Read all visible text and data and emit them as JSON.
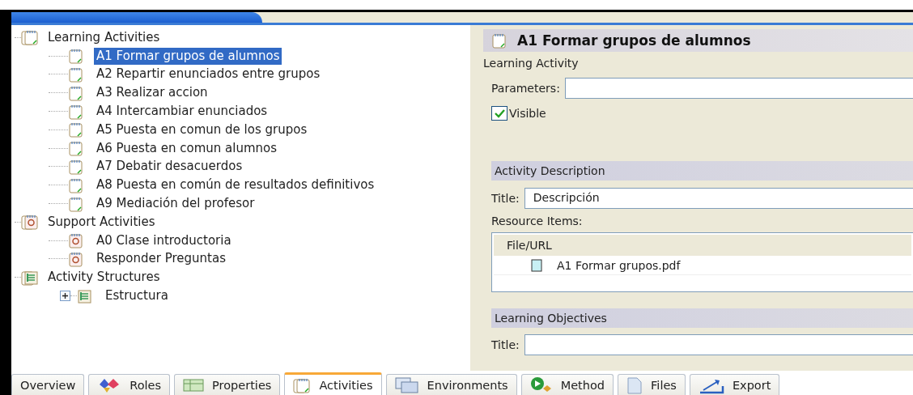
{
  "tree": [
    {
      "label": "Learning Activities",
      "kind": "activity",
      "selected": false,
      "children": [
        {
          "label": "A1 Formar grupos de alumnos",
          "kind": "activity",
          "selected": true
        },
        {
          "label": "A2 Repartir enunciados entre grupos",
          "kind": "activity",
          "selected": false
        },
        {
          "label": "A3 Realizar accion",
          "kind": "activity",
          "selected": false
        },
        {
          "label": "A4 Intercambiar enunciados",
          "kind": "activity",
          "selected": false
        },
        {
          "label": "A5 Puesta en comun de los grupos",
          "kind": "activity",
          "selected": false
        },
        {
          "label": "A6 Puesta en comun alumnos",
          "kind": "activity",
          "selected": false
        },
        {
          "label": "A7 Debatir desacuerdos",
          "kind": "activity",
          "selected": false
        },
        {
          "label": "A8 Puesta en común de resultados definitivos",
          "kind": "activity",
          "selected": false
        },
        {
          "label": "A9 Mediación del profesor",
          "kind": "activity",
          "selected": false
        }
      ]
    },
    {
      "label": "Support Activities",
      "kind": "support",
      "selected": false,
      "children": [
        {
          "label": "A0 Clase introductoria",
          "kind": "support",
          "selected": false
        },
        {
          "label": "Responder Preguntas",
          "kind": "support",
          "selected": false
        }
      ]
    },
    {
      "label": "Activity Structures",
      "kind": "structure",
      "selected": false,
      "children": [
        {
          "label": "Estructura",
          "kind": "structure",
          "selected": false,
          "expanded": false
        }
      ]
    }
  ],
  "detail": {
    "title": "A1 Formar grupos de alumnos",
    "subtitle": "Learning Activity",
    "parameters": {
      "label": "Parameters:"
    },
    "visible": {
      "label": "Visible",
      "checked": true
    },
    "activity_description": {
      "heading": "Activity Description",
      "title_label": "Title:",
      "title_value": "Descripción",
      "resources_label": "Resource Items:",
      "table": {
        "columns": [
          "File/URL"
        ],
        "rows": [
          {
            "file": "A1 Formar grupos.pdf"
          }
        ]
      }
    },
    "learning_objectives": {
      "heading": "Learning Objectives",
      "title_label": "Title:"
    }
  },
  "tabs": [
    {
      "label": "Overview",
      "kind": "overview",
      "selected": false
    },
    {
      "label": "Roles",
      "kind": "roles",
      "selected": false
    },
    {
      "label": "Properties",
      "kind": "properties",
      "selected": false
    },
    {
      "label": "Activities",
      "kind": "activity",
      "selected": true
    },
    {
      "label": "Environments",
      "kind": "environments",
      "selected": false
    },
    {
      "label": "Method",
      "kind": "method",
      "selected": false
    },
    {
      "label": "Files",
      "kind": "files",
      "selected": false
    },
    {
      "label": "Export",
      "kind": "export",
      "selected": false
    }
  ]
}
